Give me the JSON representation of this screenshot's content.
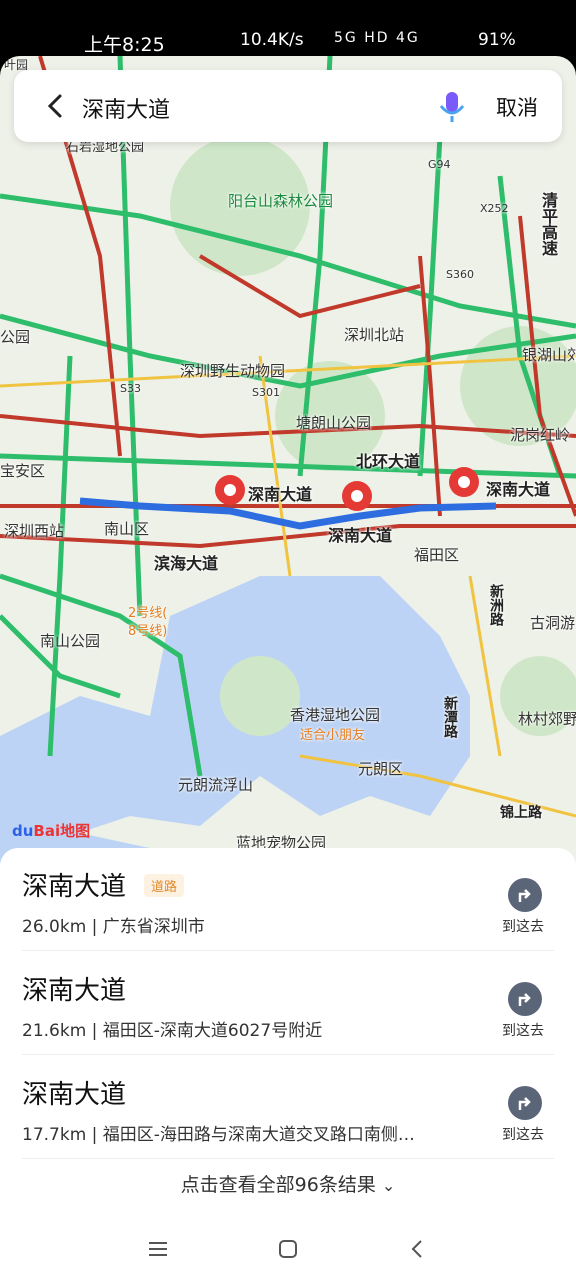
{
  "status_bar": {
    "time": "上午8:25",
    "net_speed": "10.4K/s",
    "signal_icons": "5G HD 4G",
    "battery": "91%"
  },
  "search": {
    "query": "深南大道",
    "cancel_label": "取消"
  },
  "map": {
    "labels": {
      "yangtai": "阳台山森林公园",
      "wildlife": "深圳野生动物园",
      "north_station": "深圳北站",
      "tanglang": "塘朗山公园",
      "beihuan": "北环大道",
      "shennan1": "深南大道",
      "shennan2": "深南大道",
      "shennan3": "深南大道",
      "nanshan_district": "南山区",
      "futian_district": "福田区",
      "binhai": "滨海大道",
      "shenzhen_west": "深圳西站",
      "nanshan_park": "南山公园",
      "line2": "2号线(",
      "line8": "8号线)",
      "hk_wetland": "香港湿地公园",
      "kid_friendly": "适合小朋友",
      "yuenlong_district": "元朗区",
      "yuenlong_park": "元朗流浮山",
      "landi": "蓝地宠物公园",
      "linlin": "林村郊野",
      "guodong": "古洞游",
      "yinhu": "银湖山郊",
      "nilang": "泥岗红岭",
      "baoan": "宝安区",
      "qingping": "清平高速",
      "x252": "X252",
      "s360": "S360",
      "g94": "G94",
      "s33": "S33",
      "s301": "S301",
      "xinzhou": "新洲路",
      "xintan": "新潭路",
      "jinshang": "锦上路",
      "gongyuan": "公园",
      "shibi": "石岩湿地公园",
      "yeyuan": "叶园"
    },
    "logo": "Bai地图",
    "logo_blue": "du"
  },
  "results": [
    {
      "title": "深南大道",
      "tag": "道路",
      "detail": "26.0km | 广东省深圳市",
      "action": "到这去"
    },
    {
      "title": "深南大道",
      "tag": "",
      "detail": "21.6km | 福田区-深南大道6027号附近",
      "action": "到这去"
    },
    {
      "title": "深南大道",
      "tag": "",
      "detail": "17.7km | 福田区-海田路与深南大道交叉路口南侧…",
      "action": "到这去"
    }
  ],
  "more_label": "点击查看全部96条结果",
  "colors": {
    "route": "#2d6de0",
    "pin": "#e53935",
    "highway": "#c0392b",
    "green": "#2ebd6b"
  }
}
